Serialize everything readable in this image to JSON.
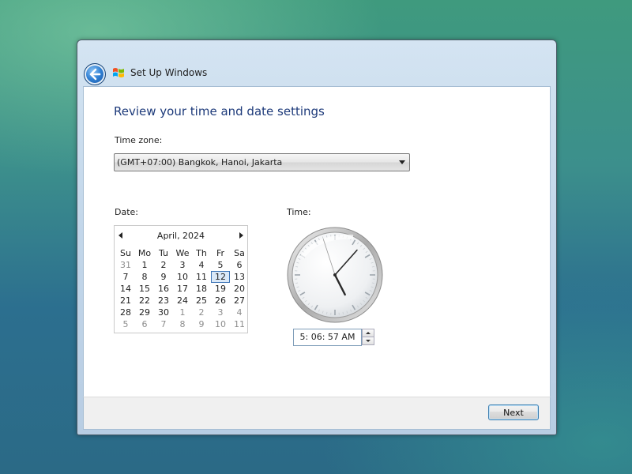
{
  "window": {
    "title": "Set Up Windows"
  },
  "page": {
    "heading": "Review your time and date settings",
    "timezone_label": "Time zone:",
    "timezone_value": "(GMT+07:00) Bangkok, Hanoi, Jakarta",
    "date_label": "Date:",
    "time_label": "Time:"
  },
  "calendar": {
    "month_title": "April, 2024",
    "weekdays": [
      "Su",
      "Mo",
      "Tu",
      "We",
      "Th",
      "Fr",
      "Sa"
    ],
    "weeks": [
      [
        {
          "d": "31",
          "o": true
        },
        {
          "d": "1"
        },
        {
          "d": "2"
        },
        {
          "d": "3"
        },
        {
          "d": "4"
        },
        {
          "d": "5"
        },
        {
          "d": "6"
        }
      ],
      [
        {
          "d": "7"
        },
        {
          "d": "8"
        },
        {
          "d": "9"
        },
        {
          "d": "10"
        },
        {
          "d": "11"
        },
        {
          "d": "12",
          "sel": true
        },
        {
          "d": "13"
        }
      ],
      [
        {
          "d": "14"
        },
        {
          "d": "15"
        },
        {
          "d": "16"
        },
        {
          "d": "17"
        },
        {
          "d": "18"
        },
        {
          "d": "19"
        },
        {
          "d": "20"
        }
      ],
      [
        {
          "d": "21"
        },
        {
          "d": "22"
        },
        {
          "d": "23"
        },
        {
          "d": "24"
        },
        {
          "d": "25"
        },
        {
          "d": "26"
        },
        {
          "d": "27"
        }
      ],
      [
        {
          "d": "28"
        },
        {
          "d": "29"
        },
        {
          "d": "30"
        },
        {
          "d": "1",
          "o": true
        },
        {
          "d": "2",
          "o": true
        },
        {
          "d": "3",
          "o": true
        },
        {
          "d": "4",
          "o": true
        }
      ],
      [
        {
          "d": "5",
          "o": true
        },
        {
          "d": "6",
          "o": true
        },
        {
          "d": "7",
          "o": true
        },
        {
          "d": "8",
          "o": true
        },
        {
          "d": "9",
          "o": true
        },
        {
          "d": "10",
          "o": true
        },
        {
          "d": "11",
          "o": true
        }
      ]
    ],
    "icons": {
      "prev": "chevron-left-icon",
      "next": "chevron-right-icon"
    }
  },
  "clock": {
    "time_text": "5:  06:  57 AM",
    "hour": 5,
    "minute": 6,
    "second": 57
  },
  "footer": {
    "next_label": "Next"
  },
  "colors": {
    "heading": "#1d3a7a",
    "selected_day_border": "#3d74b6"
  }
}
